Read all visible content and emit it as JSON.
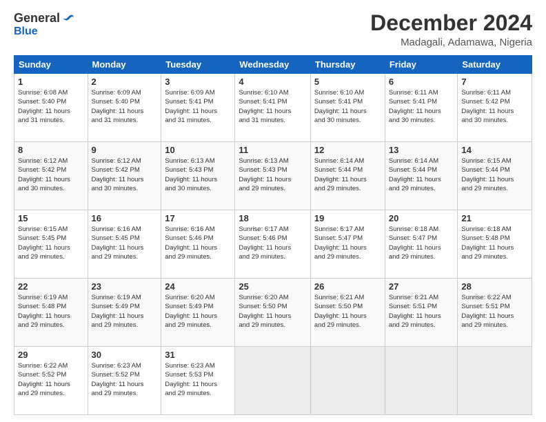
{
  "logo": {
    "general": "General",
    "blue": "Blue"
  },
  "title": "December 2024",
  "location": "Madagali, Adamawa, Nigeria",
  "days_of_week": [
    "Sunday",
    "Monday",
    "Tuesday",
    "Wednesday",
    "Thursday",
    "Friday",
    "Saturday"
  ],
  "weeks": [
    [
      {
        "day": "1",
        "sunrise": "Sunrise: 6:08 AM",
        "sunset": "Sunset: 5:40 PM",
        "daylight": "Daylight: 11 hours and 31 minutes."
      },
      {
        "day": "2",
        "sunrise": "Sunrise: 6:09 AM",
        "sunset": "Sunset: 5:40 PM",
        "daylight": "Daylight: 11 hours and 31 minutes."
      },
      {
        "day": "3",
        "sunrise": "Sunrise: 6:09 AM",
        "sunset": "Sunset: 5:41 PM",
        "daylight": "Daylight: 11 hours and 31 minutes."
      },
      {
        "day": "4",
        "sunrise": "Sunrise: 6:10 AM",
        "sunset": "Sunset: 5:41 PM",
        "daylight": "Daylight: 11 hours and 31 minutes."
      },
      {
        "day": "5",
        "sunrise": "Sunrise: 6:10 AM",
        "sunset": "Sunset: 5:41 PM",
        "daylight": "Daylight: 11 hours and 30 minutes."
      },
      {
        "day": "6",
        "sunrise": "Sunrise: 6:11 AM",
        "sunset": "Sunset: 5:41 PM",
        "daylight": "Daylight: 11 hours and 30 minutes."
      },
      {
        "day": "7",
        "sunrise": "Sunrise: 6:11 AM",
        "sunset": "Sunset: 5:42 PM",
        "daylight": "Daylight: 11 hours and 30 minutes."
      }
    ],
    [
      {
        "day": "8",
        "sunrise": "Sunrise: 6:12 AM",
        "sunset": "Sunset: 5:42 PM",
        "daylight": "Daylight: 11 hours and 30 minutes."
      },
      {
        "day": "9",
        "sunrise": "Sunrise: 6:12 AM",
        "sunset": "Sunset: 5:42 PM",
        "daylight": "Daylight: 11 hours and 30 minutes."
      },
      {
        "day": "10",
        "sunrise": "Sunrise: 6:13 AM",
        "sunset": "Sunset: 5:43 PM",
        "daylight": "Daylight: 11 hours and 30 minutes."
      },
      {
        "day": "11",
        "sunrise": "Sunrise: 6:13 AM",
        "sunset": "Sunset: 5:43 PM",
        "daylight": "Daylight: 11 hours and 29 minutes."
      },
      {
        "day": "12",
        "sunrise": "Sunrise: 6:14 AM",
        "sunset": "Sunset: 5:44 PM",
        "daylight": "Daylight: 11 hours and 29 minutes."
      },
      {
        "day": "13",
        "sunrise": "Sunrise: 6:14 AM",
        "sunset": "Sunset: 5:44 PM",
        "daylight": "Daylight: 11 hours and 29 minutes."
      },
      {
        "day": "14",
        "sunrise": "Sunrise: 6:15 AM",
        "sunset": "Sunset: 5:44 PM",
        "daylight": "Daylight: 11 hours and 29 minutes."
      }
    ],
    [
      {
        "day": "15",
        "sunrise": "Sunrise: 6:15 AM",
        "sunset": "Sunset: 5:45 PM",
        "daylight": "Daylight: 11 hours and 29 minutes."
      },
      {
        "day": "16",
        "sunrise": "Sunrise: 6:16 AM",
        "sunset": "Sunset: 5:45 PM",
        "daylight": "Daylight: 11 hours and 29 minutes."
      },
      {
        "day": "17",
        "sunrise": "Sunrise: 6:16 AM",
        "sunset": "Sunset: 5:46 PM",
        "daylight": "Daylight: 11 hours and 29 minutes."
      },
      {
        "day": "18",
        "sunrise": "Sunrise: 6:17 AM",
        "sunset": "Sunset: 5:46 PM",
        "daylight": "Daylight: 11 hours and 29 minutes."
      },
      {
        "day": "19",
        "sunrise": "Sunrise: 6:17 AM",
        "sunset": "Sunset: 5:47 PM",
        "daylight": "Daylight: 11 hours and 29 minutes."
      },
      {
        "day": "20",
        "sunrise": "Sunrise: 6:18 AM",
        "sunset": "Sunset: 5:47 PM",
        "daylight": "Daylight: 11 hours and 29 minutes."
      },
      {
        "day": "21",
        "sunrise": "Sunrise: 6:18 AM",
        "sunset": "Sunset: 5:48 PM",
        "daylight": "Daylight: 11 hours and 29 minutes."
      }
    ],
    [
      {
        "day": "22",
        "sunrise": "Sunrise: 6:19 AM",
        "sunset": "Sunset: 5:48 PM",
        "daylight": "Daylight: 11 hours and 29 minutes."
      },
      {
        "day": "23",
        "sunrise": "Sunrise: 6:19 AM",
        "sunset": "Sunset: 5:49 PM",
        "daylight": "Daylight: 11 hours and 29 minutes."
      },
      {
        "day": "24",
        "sunrise": "Sunrise: 6:20 AM",
        "sunset": "Sunset: 5:49 PM",
        "daylight": "Daylight: 11 hours and 29 minutes."
      },
      {
        "day": "25",
        "sunrise": "Sunrise: 6:20 AM",
        "sunset": "Sunset: 5:50 PM",
        "daylight": "Daylight: 11 hours and 29 minutes."
      },
      {
        "day": "26",
        "sunrise": "Sunrise: 6:21 AM",
        "sunset": "Sunset: 5:50 PM",
        "daylight": "Daylight: 11 hours and 29 minutes."
      },
      {
        "day": "27",
        "sunrise": "Sunrise: 6:21 AM",
        "sunset": "Sunset: 5:51 PM",
        "daylight": "Daylight: 11 hours and 29 minutes."
      },
      {
        "day": "28",
        "sunrise": "Sunrise: 6:22 AM",
        "sunset": "Sunset: 5:51 PM",
        "daylight": "Daylight: 11 hours and 29 minutes."
      }
    ],
    [
      {
        "day": "29",
        "sunrise": "Sunrise: 6:22 AM",
        "sunset": "Sunset: 5:52 PM",
        "daylight": "Daylight: 11 hours and 29 minutes."
      },
      {
        "day": "30",
        "sunrise": "Sunrise: 6:23 AM",
        "sunset": "Sunset: 5:52 PM",
        "daylight": "Daylight: 11 hours and 29 minutes."
      },
      {
        "day": "31",
        "sunrise": "Sunrise: 6:23 AM",
        "sunset": "Sunset: 5:53 PM",
        "daylight": "Daylight: 11 hours and 29 minutes."
      },
      null,
      null,
      null,
      null
    ]
  ]
}
